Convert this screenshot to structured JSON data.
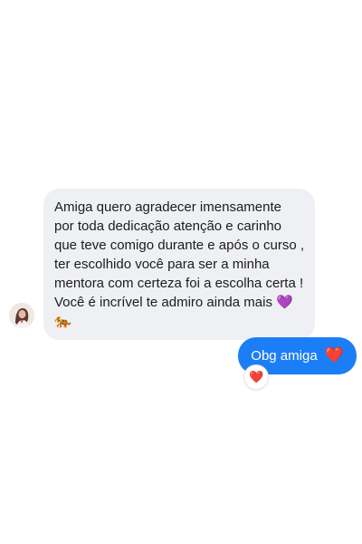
{
  "conversation": {
    "incoming_message": {
      "text": "Amiga quero agradecer imensamente por toda dedicação atenção e carinho que teve comigo durante e após o curso , ter escolhido você para ser a minha mentora com certeza foi a escolha certa ! Você é incrível te admiro ainda mais 💜🐅"
    },
    "outgoing_message": {
      "text": "Obg amiga",
      "emoji": "❤️"
    },
    "reaction": {
      "emoji": "❤️"
    }
  },
  "colors": {
    "incoming_bubble": "#eff0f3",
    "outgoing_bubble": "#1c7ef6",
    "heart": "#e8192c"
  },
  "icons": {
    "avatar": "avatar-photo",
    "reaction": "heart-icon"
  }
}
